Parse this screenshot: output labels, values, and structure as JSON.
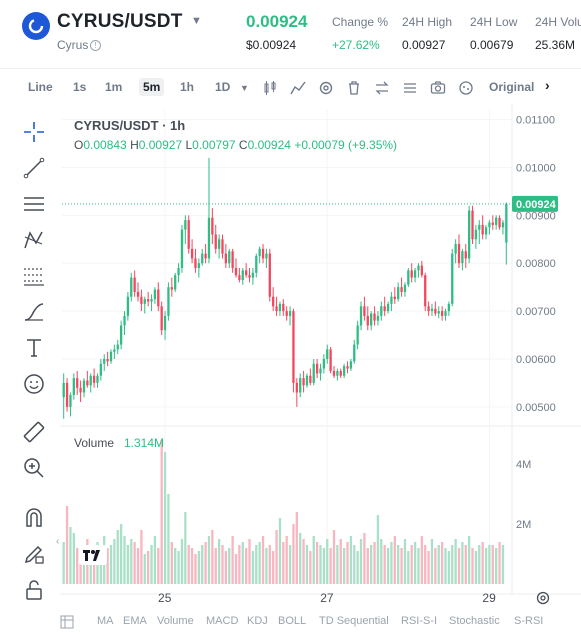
{
  "header": {
    "pair": "CYRUS/USDT",
    "name": "Cyrus",
    "price": "0.00924",
    "price_usd": "$0.00924",
    "stats": [
      {
        "label": "Change %",
        "value": "+27.62%",
        "green": true
      },
      {
        "label": "24H High",
        "value": "0.00927",
        "green": false
      },
      {
        "label": "24H Low",
        "value": "0.00679",
        "green": false
      },
      {
        "label": "24H Volu",
        "value": "25.36M",
        "green": false
      }
    ]
  },
  "toolbar": {
    "items": [
      "Line",
      "1s",
      "1m",
      "5m",
      "1h",
      "1D"
    ],
    "active": "5m",
    "original_label": "Original"
  },
  "chart": {
    "title": "CYRUS/USDT · 1h",
    "ohlc": {
      "o_label": "O",
      "o": "0.00843",
      "h_label": "H",
      "h": "0.00927",
      "l_label": "L",
      "l": "0.00797",
      "c_label": "C",
      "c": "0.00924",
      "change": "+0.00079 (+9.35%)"
    },
    "current_price_label": "0.00924",
    "volume_label": "Volume",
    "volume_value": "1.314M",
    "y_ticks": [
      "0.01100",
      "0.01000",
      "0.00900",
      "0.00800",
      "0.00700",
      "0.00600",
      "0.00500"
    ],
    "vol_ticks": [
      "4M",
      "2M"
    ],
    "x_ticks": [
      "25",
      "27",
      "29"
    ],
    "colors": {
      "up": "#2ebd85",
      "down": "#f6465d"
    }
  },
  "chart_data": {
    "type": "candlestick",
    "y_range": [
      0.0046,
      0.0112
    ],
    "current_price": 0.00924,
    "vol_range": [
      0,
      5000000
    ],
    "x_ticks_index": {
      "25": 30,
      "27": 78,
      "29": 126
    },
    "candles": [
      [
        0.0052,
        0.0057,
        0.00475,
        0.0055
      ],
      [
        0.0055,
        0.0056,
        0.0049,
        0.005
      ],
      [
        0.005,
        0.0053,
        0.0048,
        0.00525
      ],
      [
        0.00525,
        0.0057,
        0.00515,
        0.0056
      ],
      [
        0.0056,
        0.00575,
        0.00525,
        0.0054
      ],
      [
        0.0054,
        0.00555,
        0.0051,
        0.0053
      ],
      [
        0.0053,
        0.0056,
        0.0052,
        0.00555
      ],
      [
        0.00555,
        0.00575,
        0.0054,
        0.00545
      ],
      [
        0.00545,
        0.0057,
        0.0053,
        0.00565
      ],
      [
        0.00565,
        0.0058,
        0.0054,
        0.0055
      ],
      [
        0.0055,
        0.0057,
        0.0054,
        0.00565
      ],
      [
        0.00565,
        0.006,
        0.00555,
        0.0059
      ],
      [
        0.0059,
        0.0061,
        0.00575,
        0.006
      ],
      [
        0.006,
        0.00615,
        0.00585,
        0.00595
      ],
      [
        0.00595,
        0.0062,
        0.0059,
        0.00615
      ],
      [
        0.00615,
        0.0063,
        0.006,
        0.0062
      ],
      [
        0.0062,
        0.0064,
        0.0061,
        0.0063
      ],
      [
        0.0063,
        0.0068,
        0.0062,
        0.0067
      ],
      [
        0.0067,
        0.007,
        0.0065,
        0.0069
      ],
      [
        0.0069,
        0.0074,
        0.0068,
        0.0073
      ],
      [
        0.0073,
        0.0078,
        0.0072,
        0.0077
      ],
      [
        0.0077,
        0.00785,
        0.0073,
        0.0074
      ],
      [
        0.0074,
        0.0076,
        0.0072,
        0.0073
      ],
      [
        0.0073,
        0.00745,
        0.007,
        0.00715
      ],
      [
        0.00715,
        0.0073,
        0.00695,
        0.00725
      ],
      [
        0.00725,
        0.0074,
        0.0071,
        0.0072
      ],
      [
        0.0072,
        0.00735,
        0.007,
        0.00725
      ],
      [
        0.00725,
        0.0075,
        0.00715,
        0.00745
      ],
      [
        0.00745,
        0.0076,
        0.007,
        0.0071
      ],
      [
        0.0071,
        0.0072,
        0.0065,
        0.0066
      ],
      [
        0.0066,
        0.007,
        0.0064,
        0.0069
      ],
      [
        0.0069,
        0.0076,
        0.0068,
        0.0075
      ],
      [
        0.0075,
        0.0077,
        0.0073,
        0.00745
      ],
      [
        0.00745,
        0.0078,
        0.0074,
        0.00775
      ],
      [
        0.00775,
        0.008,
        0.0076,
        0.0079
      ],
      [
        0.0079,
        0.0088,
        0.0078,
        0.0087
      ],
      [
        0.0087,
        0.009,
        0.0084,
        0.0089
      ],
      [
        0.0089,
        0.009,
        0.0082,
        0.0083
      ],
      [
        0.0083,
        0.0085,
        0.008,
        0.0081
      ],
      [
        0.0081,
        0.0083,
        0.0078,
        0.0079
      ],
      [
        0.0079,
        0.0081,
        0.0077,
        0.008
      ],
      [
        0.008,
        0.0083,
        0.00795,
        0.0082
      ],
      [
        0.0082,
        0.0084,
        0.008,
        0.0081
      ],
      [
        0.0081,
        0.0102,
        0.008,
        0.00895
      ],
      [
        0.00895,
        0.00915,
        0.0084,
        0.0086
      ],
      [
        0.0086,
        0.0088,
        0.0082,
        0.0083
      ],
      [
        0.0083,
        0.0086,
        0.0081,
        0.0085
      ],
      [
        0.0085,
        0.0086,
        0.0081,
        0.0082
      ],
      [
        0.0082,
        0.0084,
        0.0079,
        0.008
      ],
      [
        0.008,
        0.0083,
        0.0079,
        0.00825
      ],
      [
        0.00825,
        0.0083,
        0.0078,
        0.0079
      ],
      [
        0.0079,
        0.0081,
        0.0077,
        0.00775
      ],
      [
        0.00775,
        0.0079,
        0.0076,
        0.00765
      ],
      [
        0.00765,
        0.0079,
        0.00755,
        0.00785
      ],
      [
        0.00785,
        0.008,
        0.0077,
        0.00775
      ],
      [
        0.00775,
        0.0079,
        0.0076,
        0.0077
      ],
      [
        0.0077,
        0.0079,
        0.00755,
        0.0078
      ],
      [
        0.0078,
        0.0082,
        0.0077,
        0.00815
      ],
      [
        0.00815,
        0.00835,
        0.008,
        0.0083
      ],
      [
        0.0083,
        0.0084,
        0.008,
        0.0081
      ],
      [
        0.0081,
        0.0083,
        0.0079,
        0.0082
      ],
      [
        0.0082,
        0.0083,
        0.0072,
        0.0073
      ],
      [
        0.0073,
        0.0075,
        0.007,
        0.0071
      ],
      [
        0.0071,
        0.0073,
        0.0069,
        0.007
      ],
      [
        0.007,
        0.0072,
        0.0069,
        0.00715
      ],
      [
        0.00715,
        0.00725,
        0.0069,
        0.007
      ],
      [
        0.007,
        0.0071,
        0.0068,
        0.0069
      ],
      [
        0.0069,
        0.0071,
        0.0067,
        0.007
      ],
      [
        0.007,
        0.00705,
        0.0053,
        0.0055
      ],
      [
        0.0055,
        0.0056,
        0.005,
        0.0053
      ],
      [
        0.0053,
        0.0057,
        0.0052,
        0.0056
      ],
      [
        0.0056,
        0.00575,
        0.0053,
        0.00545
      ],
      [
        0.00545,
        0.0057,
        0.0054,
        0.00565
      ],
      [
        0.00565,
        0.0058,
        0.00545,
        0.0055
      ],
      [
        0.0055,
        0.006,
        0.00545,
        0.0059
      ],
      [
        0.0059,
        0.006,
        0.0056,
        0.0057
      ],
      [
        0.0057,
        0.0059,
        0.00555,
        0.0058
      ],
      [
        0.0058,
        0.0061,
        0.0057,
        0.006
      ],
      [
        0.006,
        0.0063,
        0.0059,
        0.0062
      ],
      [
        0.0062,
        0.00625,
        0.0057,
        0.00575
      ],
      [
        0.00575,
        0.00585,
        0.0056,
        0.00565
      ],
      [
        0.00565,
        0.0058,
        0.00555,
        0.00575
      ],
      [
        0.00575,
        0.0058,
        0.0056,
        0.00565
      ],
      [
        0.00565,
        0.0059,
        0.0056,
        0.00585
      ],
      [
        0.00585,
        0.00595,
        0.0057,
        0.0058
      ],
      [
        0.0058,
        0.006,
        0.00575,
        0.00595
      ],
      [
        0.00595,
        0.0064,
        0.0059,
        0.0063
      ],
      [
        0.0063,
        0.0068,
        0.0062,
        0.0067
      ],
      [
        0.0067,
        0.0072,
        0.0066,
        0.0071
      ],
      [
        0.0071,
        0.0073,
        0.0068,
        0.0069
      ],
      [
        0.0069,
        0.0071,
        0.0066,
        0.0067
      ],
      [
        0.0067,
        0.007,
        0.0066,
        0.00695
      ],
      [
        0.00695,
        0.0071,
        0.0067,
        0.0068
      ],
      [
        0.0068,
        0.007,
        0.0067,
        0.0069
      ],
      [
        0.0069,
        0.0072,
        0.0068,
        0.0071
      ],
      [
        0.0071,
        0.0073,
        0.0069,
        0.007
      ],
      [
        0.007,
        0.0072,
        0.00695,
        0.00715
      ],
      [
        0.00715,
        0.0074,
        0.007,
        0.0073
      ],
      [
        0.0073,
        0.0075,
        0.00715,
        0.00725
      ],
      [
        0.00725,
        0.0076,
        0.0072,
        0.0075
      ],
      [
        0.0075,
        0.0077,
        0.0073,
        0.0074
      ],
      [
        0.0074,
        0.0076,
        0.0073,
        0.00755
      ],
      [
        0.00755,
        0.0079,
        0.0075,
        0.00785
      ],
      [
        0.00785,
        0.008,
        0.0076,
        0.0077
      ],
      [
        0.0077,
        0.0079,
        0.0076,
        0.00785
      ],
      [
        0.00785,
        0.008,
        0.0077,
        0.00795
      ],
      [
        0.00795,
        0.00805,
        0.0077,
        0.00775
      ],
      [
        0.00775,
        0.0078,
        0.007,
        0.0071
      ],
      [
        0.0071,
        0.0072,
        0.0069,
        0.007
      ],
      [
        0.007,
        0.00715,
        0.0069,
        0.00705
      ],
      [
        0.00705,
        0.0072,
        0.0069,
        0.00695
      ],
      [
        0.00695,
        0.0071,
        0.00685,
        0.007
      ],
      [
        0.007,
        0.0071,
        0.0068,
        0.0069
      ],
      [
        0.0069,
        0.00705,
        0.0068,
        0.007
      ],
      [
        0.007,
        0.0072,
        0.0069,
        0.00715
      ],
      [
        0.00715,
        0.0083,
        0.0071,
        0.0082
      ],
      [
        0.0082,
        0.0085,
        0.008,
        0.0084
      ],
      [
        0.0084,
        0.0086,
        0.0079,
        0.008
      ],
      [
        0.008,
        0.0083,
        0.00785,
        0.00825
      ],
      [
        0.00825,
        0.0084,
        0.0079,
        0.0081
      ],
      [
        0.0081,
        0.0092,
        0.008,
        0.0091
      ],
      [
        0.0091,
        0.0092,
        0.0084,
        0.0085
      ],
      [
        0.0085,
        0.0088,
        0.0083,
        0.0087
      ],
      [
        0.0087,
        0.0089,
        0.0084,
        0.0088
      ],
      [
        0.0088,
        0.009,
        0.0085,
        0.0086
      ],
      [
        0.0086,
        0.0088,
        0.0085,
        0.00875
      ],
      [
        0.00875,
        0.0089,
        0.0086,
        0.00885
      ],
      [
        0.00885,
        0.009,
        0.0087,
        0.0088
      ],
      [
        0.0088,
        0.009,
        0.0087,
        0.00895
      ],
      [
        0.00895,
        0.009,
        0.0087,
        0.00875
      ],
      [
        0.00875,
        0.0089,
        0.0086,
        0.00885
      ],
      [
        0.00843,
        0.00927,
        0.00797,
        0.00924
      ]
    ],
    "volumes": [
      1.4,
      2.6,
      1.9,
      1.7,
      1.2,
      1.0,
      1.1,
      1.5,
      1.2,
      1.3,
      1.4,
      1.1,
      1.6,
      1.2,
      1.3,
      1.5,
      1.8,
      2.0,
      1.6,
      1.3,
      1.5,
      1.4,
      1.2,
      1.8,
      1.0,
      1.1,
      1.3,
      1.6,
      1.2,
      4.8,
      4.4,
      3.0,
      1.4,
      1.2,
      1.1,
      1.5,
      2.4,
      1.3,
      1.2,
      1.0,
      1.1,
      1.3,
      1.4,
      1.6,
      1.8,
      1.2,
      1.5,
      1.3,
      1.1,
      1.2,
      1.6,
      1.0,
      1.3,
      1.4,
      1.2,
      1.5,
      1.1,
      1.3,
      1.4,
      1.6,
      1.2,
      1.3,
      1.1,
      1.8,
      2.2,
      1.4,
      1.6,
      1.3,
      2.0,
      2.4,
      1.7,
      1.5,
      1.3,
      1.1,
      1.6,
      1.4,
      1.3,
      1.2,
      1.5,
      1.2,
      1.8,
      1.3,
      1.5,
      1.2,
      1.4,
      1.6,
      1.3,
      1.1,
      1.5,
      1.7,
      1.2,
      1.3,
      1.4,
      2.3,
      1.5,
      1.3,
      1.2,
      1.4,
      1.6,
      1.3,
      1.2,
      1.5,
      1.1,
      1.3,
      1.4,
      1.2,
      1.6,
      1.3,
      1.1,
      1.5,
      1.2,
      1.3,
      1.4,
      1.2,
      1.1,
      1.3,
      1.5,
      1.2,
      1.4,
      1.3,
      1.6,
      1.2,
      1.1,
      1.3,
      1.4,
      1.2,
      1.3,
      1.3,
      1.2,
      1.4,
      1.3
    ]
  },
  "left_tools": [
    "crosshair-icon",
    "trendline-icon",
    "parallel-channel-icon",
    "pattern-icon",
    "fib-icon",
    "brush-icon",
    "text-icon",
    "emoji-icon",
    "ruler-icon",
    "zoom-in-icon",
    "magnet-icon",
    "lock-draw-icon",
    "unlock-icon"
  ],
  "indicators": [
    "MA",
    "EMA",
    "Volume",
    "MACD",
    "KDJ",
    "BOLL",
    "TD Sequential",
    "RSI-S-I",
    "Stochastic",
    "S-RSI"
  ]
}
